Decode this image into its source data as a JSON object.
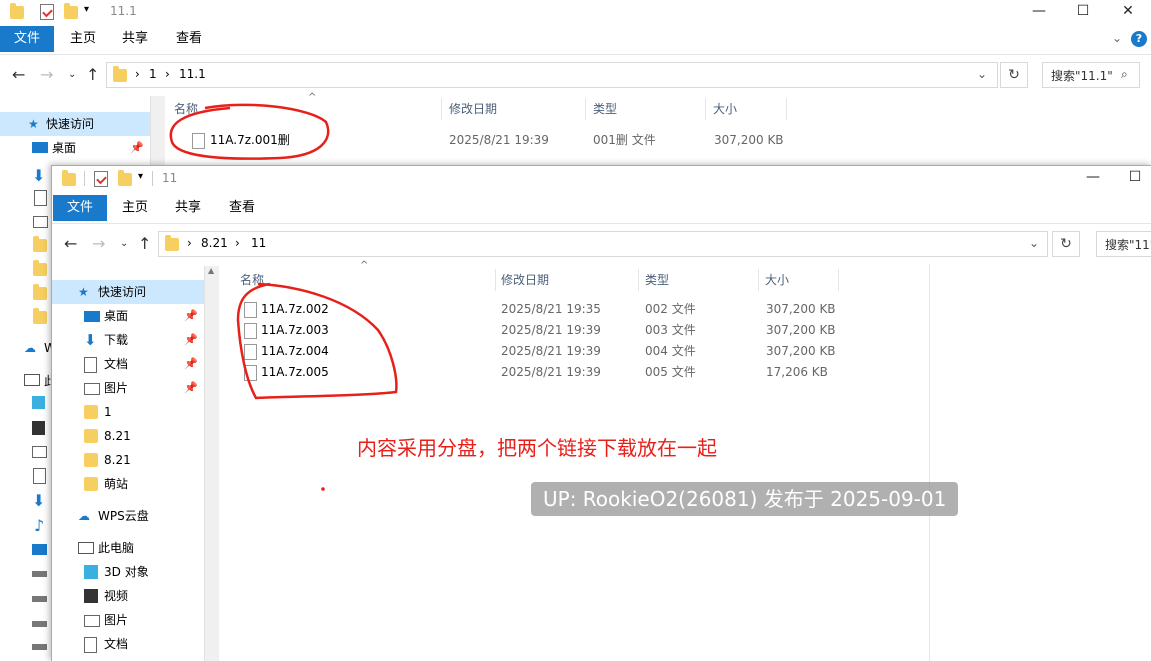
{
  "back_window": {
    "title": "11.1",
    "ribbon_tabs": [
      "文件",
      "主页",
      "共享",
      "查看"
    ],
    "breadcrumb": [
      "1",
      "11.1"
    ],
    "search_placeholder": "搜索\"11.1\"",
    "columns": [
      "名称",
      "修改日期",
      "类型",
      "大小"
    ],
    "files": [
      {
        "name": "11A.7z.001删",
        "date": "2025/8/21 19:39",
        "type": "001删 文件",
        "size": "307,200 KB"
      }
    ],
    "sidebar": {
      "quick_access": "快速访问",
      "desktop": "桌面"
    }
  },
  "front_window": {
    "title": "11",
    "ribbon_tabs": [
      "文件",
      "主页",
      "共享",
      "查看"
    ],
    "breadcrumb": [
      "8.21",
      "11"
    ],
    "search_placeholder": "搜索\"11\"",
    "columns": [
      "名称",
      "修改日期",
      "类型",
      "大小"
    ],
    "files": [
      {
        "name": "11A.7z.002",
        "date": "2025/8/21 19:35",
        "type": "002 文件",
        "size": "307,200 KB"
      },
      {
        "name": "11A.7z.003",
        "date": "2025/8/21 19:39",
        "type": "003 文件",
        "size": "307,200 KB"
      },
      {
        "name": "11A.7z.004",
        "date": "2025/8/21 19:39",
        "type": "004 文件",
        "size": "307,200 KB"
      },
      {
        "name": "11A.7z.005",
        "date": "2025/8/21 19:39",
        "type": "005 文件",
        "size": "17,206 KB"
      }
    ],
    "sidebar": [
      {
        "label": "快速访问",
        "icon": "star-icon",
        "kind": "header"
      },
      {
        "label": "桌面",
        "icon": "desktop-icon",
        "pinned": true
      },
      {
        "label": "下载",
        "icon": "download-icon",
        "pinned": true
      },
      {
        "label": "文档",
        "icon": "document-icon",
        "pinned": true
      },
      {
        "label": "图片",
        "icon": "picture-icon",
        "pinned": true
      },
      {
        "label": "1",
        "icon": "folder-icon"
      },
      {
        "label": "8.21",
        "icon": "folder-icon"
      },
      {
        "label": "8.21",
        "icon": "folder-icon"
      },
      {
        "label": "萌站",
        "icon": "folder-icon"
      },
      {
        "label": "WPS云盘",
        "icon": "cloud-icon",
        "kind": "header"
      },
      {
        "label": "此电脑",
        "icon": "computer-icon",
        "kind": "header"
      },
      {
        "label": "3D 对象",
        "icon": "cube-icon"
      },
      {
        "label": "视频",
        "icon": "video-icon"
      },
      {
        "label": "图片",
        "icon": "picture-icon"
      },
      {
        "label": "文档",
        "icon": "document-icon"
      }
    ]
  },
  "left_strip": {
    "wps_label": "W",
    "pc_label": "此"
  },
  "annotation": "内容采用分盘，把两个链接下载放在一起",
  "watermark": "UP: RookieO2(26081) 发布于 2025-09-01",
  "colors": {
    "accent": "#1979ca",
    "selection": "#cce8ff",
    "annotation": "#e8201a"
  }
}
